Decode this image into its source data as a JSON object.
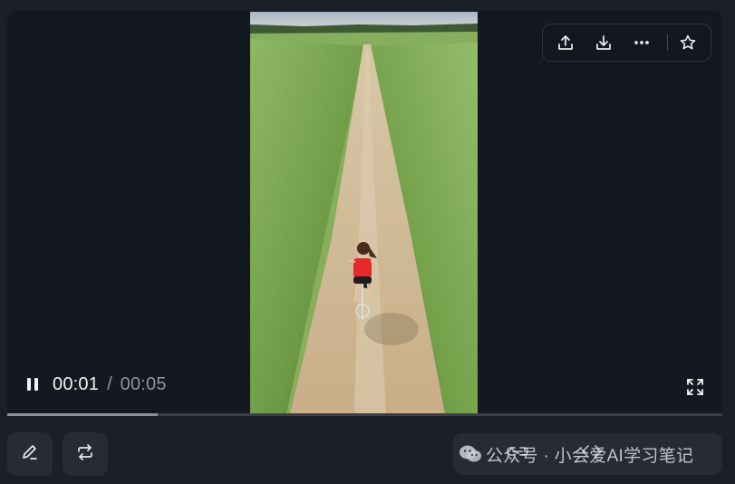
{
  "player": {
    "current_time": "00:01",
    "time_separator": "/",
    "total_time": "00:05",
    "progress_fraction": 0.21
  },
  "top_actions": {
    "icons": [
      "share-icon",
      "download-icon",
      "more-icon",
      "star-icon"
    ]
  },
  "bottom_tools": {
    "icons": [
      "edit-icon",
      "loop-icon"
    ]
  },
  "watermark": {
    "text": "公众号 · 小会爱AI学习笔记",
    "icon": "wechat-icon"
  },
  "colors": {
    "background": "#1b1f27",
    "player_bg": "#141820",
    "button_bg": "#262b35",
    "progress_track": "#3a404b",
    "progress_fill": "#8a909b"
  }
}
